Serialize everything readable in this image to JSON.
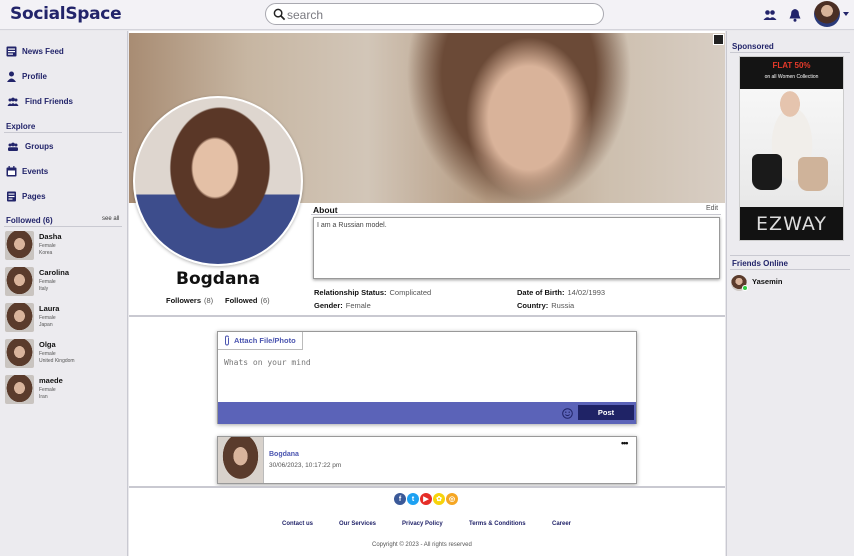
{
  "header": {
    "logo": "SocialSpace",
    "search_placeholder": "search",
    "icons": [
      "people-icon",
      "bell-icon"
    ]
  },
  "sidebar": {
    "nav": [
      {
        "label": "News Feed",
        "icon": "newspaper-icon"
      },
      {
        "label": "Profile",
        "icon": "user-icon"
      },
      {
        "label": "Find Friends",
        "icon": "friends-icon"
      }
    ],
    "explore_title": "Explore",
    "explore": [
      {
        "label": "Groups",
        "icon": "groups-icon"
      },
      {
        "label": "Events",
        "icon": "calendar-icon"
      },
      {
        "label": "Pages",
        "icon": "pages-icon"
      }
    ],
    "followed_title": "Followed (6)",
    "see_all": "see all",
    "followed": [
      {
        "name": "Dasha",
        "sex": "Female",
        "country": "Korea"
      },
      {
        "name": "Carolina",
        "sex": "Female",
        "country": "Italy"
      },
      {
        "name": "Laura",
        "sex": "Female",
        "country": "Japan"
      },
      {
        "name": "Olga",
        "sex": "Female",
        "country": "United Kingdom"
      },
      {
        "name": "maede",
        "sex": "Female",
        "country": "Iran"
      }
    ]
  },
  "profile": {
    "name": "Bogdana",
    "followers_label": "Followers",
    "followers_count": "(8)",
    "followed_label": "Followed",
    "followed_count": "(6)",
    "about_title": "About",
    "about_edit": "Edit",
    "about_text": "I am a Russian model.",
    "relationship_label": "Relationship Status:",
    "relationship_value": "Complicated",
    "dob_label": "Date of Birth:",
    "dob_value": "14/02/1993",
    "gender_label": "Gender:",
    "gender_value": "Female",
    "country_label": "Country:",
    "country_value": "Russia"
  },
  "composer": {
    "attach_label": "Attach File/Photo",
    "placeholder": "Whats on your mind",
    "post_label": "Post"
  },
  "post": {
    "author": "Bogdana",
    "date": "30/06/2023, 10:17:22 pm",
    "menu": "•••"
  },
  "footer": {
    "links": [
      "Contact us",
      "Our Services",
      "Privacy Policy",
      "Terms & Conditions",
      "Career"
    ],
    "copyright": "Copyright © 2023 - All rights reserved",
    "socials": [
      {
        "icon": "facebook-icon",
        "glyph": "f",
        "color": "#3b5998"
      },
      {
        "icon": "twitter-icon",
        "glyph": "t",
        "color": "#1da1f2"
      },
      {
        "icon": "youtube-icon",
        "glyph": "▶",
        "color": "#e52d27"
      },
      {
        "icon": "snapchat-icon",
        "glyph": "✿",
        "color": "#f7d30a"
      },
      {
        "icon": "instagram-icon",
        "glyph": "◎",
        "color": "#f5a623"
      }
    ]
  },
  "right": {
    "sponsored_title": "Sponsored",
    "ad_flat": "FLAT 50%",
    "ad_sub": "on all Women Collection",
    "ad_brand": "EZWAY",
    "online_title": "Friends Online",
    "online": [
      {
        "name": "Yasemin"
      }
    ]
  },
  "colors": {
    "brand": "#22246a",
    "accent": "#5b63b8",
    "button": "#1f2366",
    "online": "#2ecc40"
  }
}
